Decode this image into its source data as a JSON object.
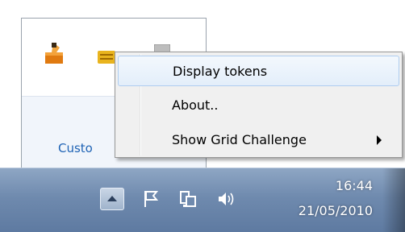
{
  "popup": {
    "footer_link": "Custo"
  },
  "tray": {
    "clock_time": "16:44",
    "clock_date": "21/05/2010"
  },
  "context_menu": {
    "items": [
      {
        "label": "Display tokens"
      },
      {
        "label": "About.."
      },
      {
        "label": "Show Grid Challenge"
      }
    ]
  },
  "icons": {
    "app": "tokens-app-icon",
    "card": "card-icon",
    "gray": "device-icon",
    "show_hidden": "chevron-up-icon",
    "flag": "action-center-flag-icon",
    "network": "network-icon",
    "volume": "volume-icon",
    "submenu": "submenu-arrow-icon"
  },
  "colors": {
    "link": "#1f63b5",
    "menu_highlight_border": "#aecdf0",
    "taskbar": "#6f8aae"
  }
}
